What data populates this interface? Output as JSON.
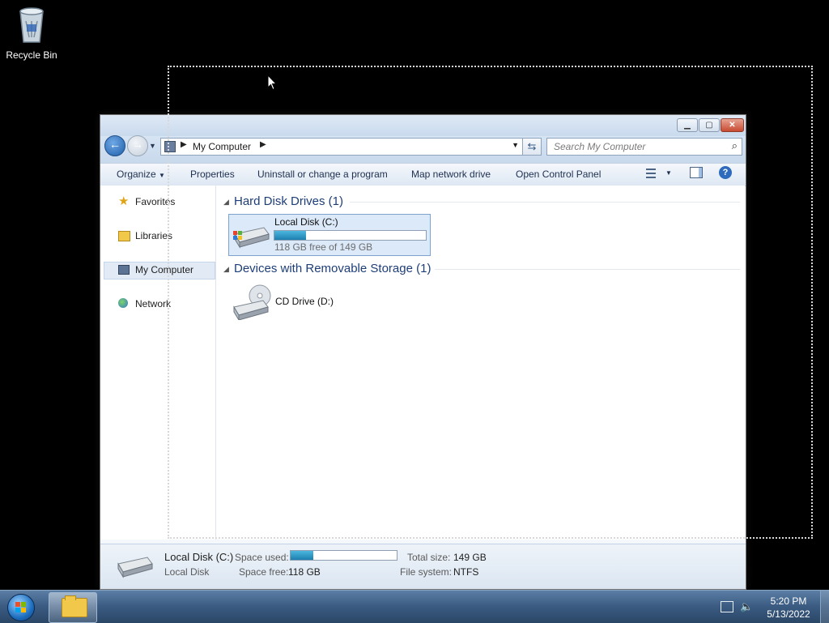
{
  "desktop": {
    "recycle_bin_label": "Recycle Bin"
  },
  "window": {
    "address": {
      "crumb": "My Computer"
    },
    "search": {
      "placeholder": "Search My Computer"
    },
    "toolbar": {
      "organize": "Organize",
      "properties": "Properties",
      "uninstall": "Uninstall or change a program",
      "map_drive": "Map network drive",
      "control_panel": "Open Control Panel"
    },
    "nav": {
      "favorites": "Favorites",
      "libraries": "Libraries",
      "my_computer": "My Computer",
      "network": "Network"
    },
    "groups": {
      "hard_disk": "Hard Disk Drives (1)",
      "removable": "Devices with Removable Storage (1)"
    },
    "drives": {
      "c_name": "Local Disk (C:)",
      "c_free": "118 GB free of 149 GB",
      "c_used_fraction": 0.21,
      "d_name": "CD Drive (D:)"
    },
    "details": {
      "name": "Local Disk (C:)",
      "type": "Local Disk",
      "space_used_label": "Space used:",
      "space_free_label": "Space free:",
      "space_free_value": "118 GB",
      "total_size_label": "Total size:",
      "total_size_value": "149 GB",
      "file_system_label": "File system:",
      "file_system_value": "NTFS"
    }
  },
  "taskbar": {
    "time": "5:20 PM",
    "date": "5/13/2022"
  },
  "colors": {
    "accent": "#1e3e78",
    "progress": "#1d7fb0",
    "desktop": "#000000"
  }
}
